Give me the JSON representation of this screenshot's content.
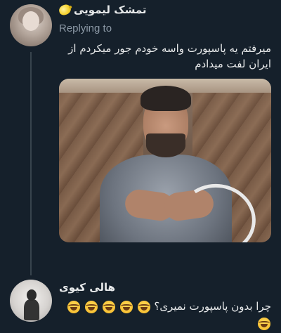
{
  "tweets": [
    {
      "author": "تمشک لیمویی",
      "author_emoji": "lemon-icon",
      "replying_label": "Replying to",
      "text": "میرفتم یه پاسپورت واسه خودم جور میکردم از ایران لفت میدادم",
      "has_media": true
    },
    {
      "author": "هالی کیوی",
      "text": "چرا بدون پاسپورت نمیری؟",
      "trailing_emojis": [
        "laugh-emoji",
        "laugh-emoji",
        "laugh-emoji",
        "laugh-emoji",
        "laugh-emoji",
        "laugh-emoji"
      ]
    }
  ],
  "colors": {
    "background": "#15202b",
    "primary_text": "#e7e9ea",
    "secondary_text": "#8b98a5",
    "thread_line": "#38444d"
  }
}
